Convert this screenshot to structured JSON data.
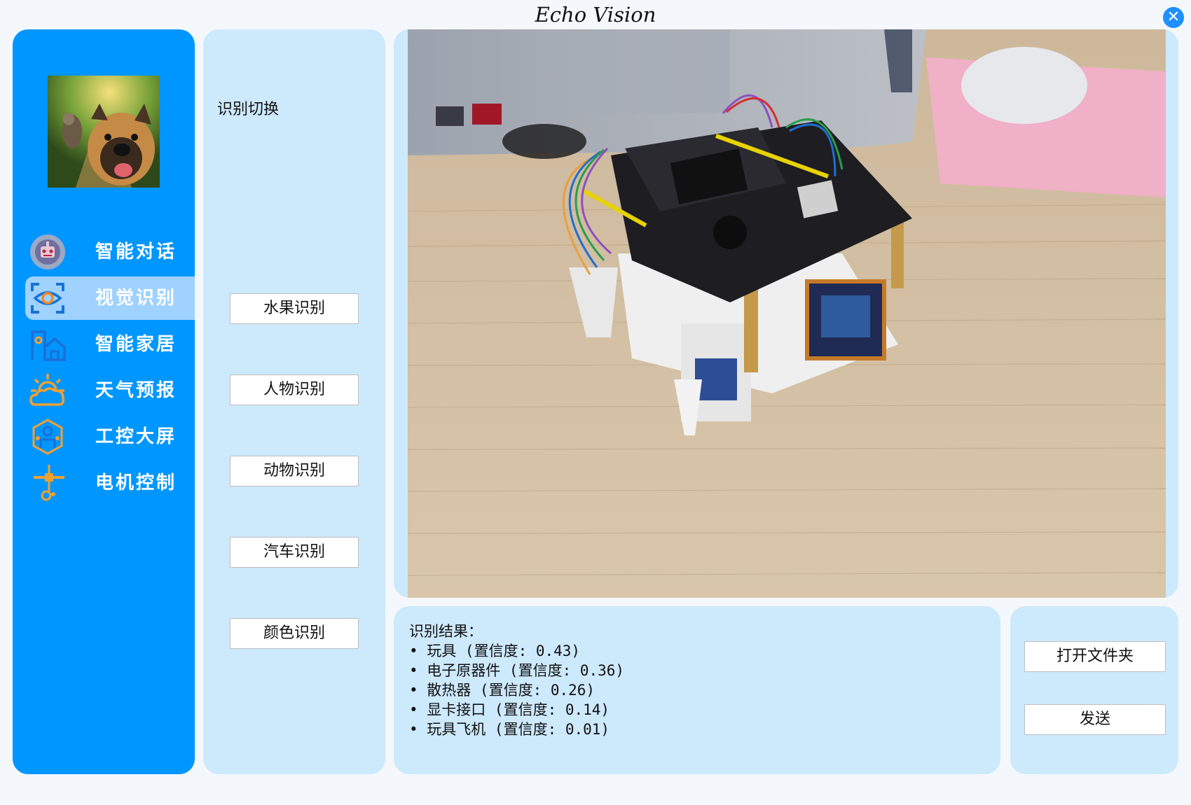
{
  "window": {
    "title": "Echo Vision",
    "close_glyph": "✕"
  },
  "sidebar": {
    "items": [
      {
        "label": "智能对话",
        "icon": "chat-robot-icon",
        "active": false
      },
      {
        "label": "视觉识别",
        "icon": "vision-eye-icon",
        "active": true
      },
      {
        "label": "智能家居",
        "icon": "smart-home-icon",
        "active": false
      },
      {
        "label": "天气预报",
        "icon": "weather-icon",
        "active": false
      },
      {
        "label": "工控大屏",
        "icon": "industrial-screen-icon",
        "active": false
      },
      {
        "label": "电机控制",
        "icon": "motor-control-icon",
        "active": false
      }
    ]
  },
  "recognition": {
    "switch_label": "识别切换",
    "modes": [
      "水果识别",
      "人物识别",
      "动物识别",
      "汽车识别",
      "颜色识别"
    ]
  },
  "result": {
    "heading": "识别结果：",
    "items": [
      "• 玩具 (置信度: 0.43)",
      "• 电子原器件 (置信度: 0.36)",
      "• 散热器 (置信度: 0.26)",
      "• 显卡接口 (置信度: 0.14)",
      "• 玩具飞机 (置信度: 0.01)"
    ]
  },
  "actions": {
    "open_folder": "打开文件夹",
    "send": "发送"
  },
  "colors": {
    "sidebar": "#0096ff",
    "panel": "#cde9fc",
    "active_item": "#9fd2ff",
    "accent": "#1e90ff"
  }
}
